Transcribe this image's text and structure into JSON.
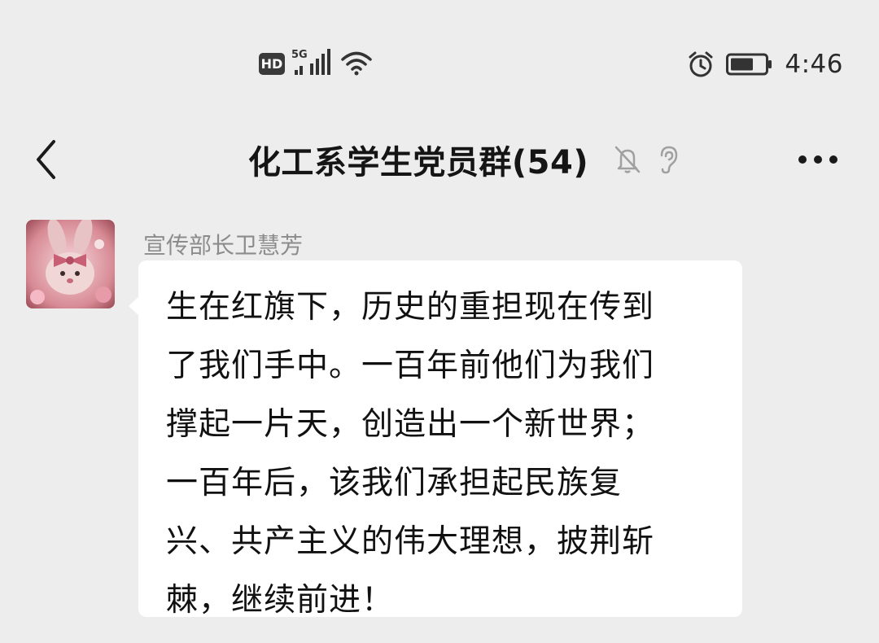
{
  "status_bar": {
    "hd_label": "HD",
    "network_label": "5G",
    "time": "4:46",
    "icons": [
      "hd-icon",
      "signal-icon",
      "wifi-icon",
      "alarm-icon",
      "battery-icon"
    ]
  },
  "header": {
    "title": "化工系学生党员群(54)",
    "icons": [
      "back-icon",
      "mute-bell-icon",
      "ear-icon",
      "more-icon"
    ]
  },
  "message": {
    "sender": "宣传部长卫慧芳",
    "text": "生在红旗下，历史的重担现在传到\n了我们手中。一百年前他们为我们\n撑起一片天，创造出一个新世界；\n一百年后，该我们承担起民族复\n兴、共产主义的伟大理想，披荆斩\n棘，继续前进！"
  },
  "colors": {
    "background": "#ededed",
    "bubble": "#ffffff",
    "sender_name": "#8c8c8c",
    "title": "#151515"
  }
}
